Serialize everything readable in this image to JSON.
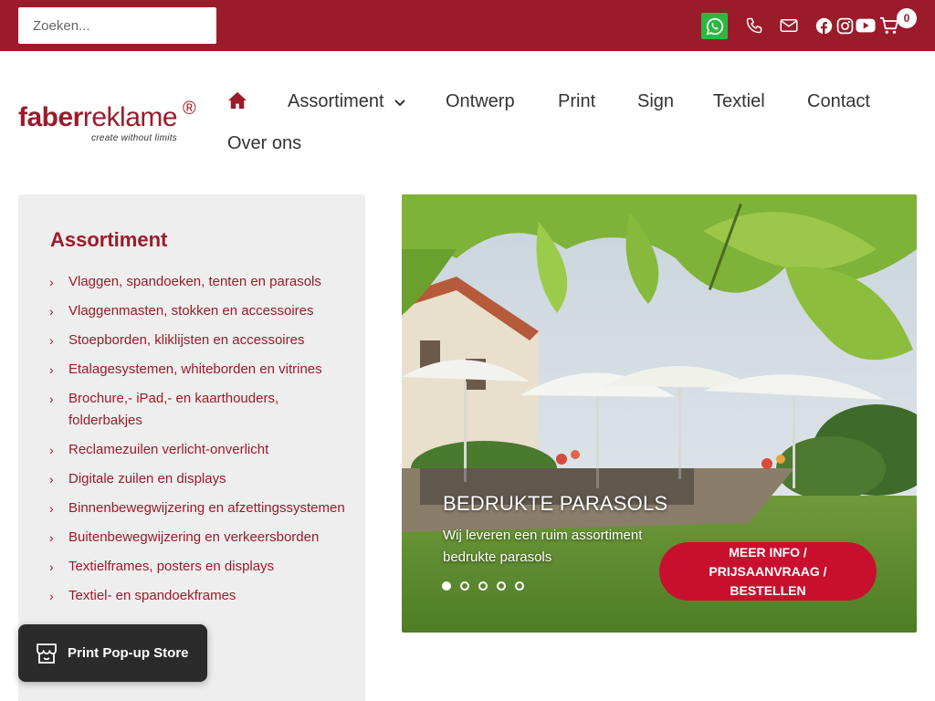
{
  "topbar": {
    "search_placeholder": "Zoeken...",
    "cart_count": "0",
    "icons": [
      "whatsapp-icon",
      "phone-icon",
      "mail-icon",
      "facebook-icon",
      "instagram-icon",
      "youtube-icon",
      "cart-icon"
    ]
  },
  "logo": {
    "word_bold": "faber",
    "word_light": "reklame",
    "registered": "®",
    "tagline": "create without limits"
  },
  "nav": {
    "home_icon": "home-icon",
    "items": [
      "Assortiment",
      "Ontwerp",
      "Print",
      "Sign",
      "Textiel",
      "Contact",
      "Over ons"
    ]
  },
  "sidebar": {
    "title": "Assortiment",
    "items": [
      "Vlaggen, spandoeken, tenten en parasols",
      "Vlaggenmasten, stokken en accessoires",
      "Stoepborden, kliklijsten en accessoires",
      "Etalagesystemen, whiteborden en vitrines",
      "Brochure,- iPad,- en kaarthouders, folderbakjes",
      "Reclamezuilen verlicht-onverlicht",
      "Digitale zuilen en displays",
      "Binnenbewegwijzering en afzettingssystemen",
      "Buitenbewegwijzering en verkeersborden",
      "Textielframes, posters en displays",
      "Textiel- en spandoekframes"
    ]
  },
  "hero": {
    "title": "BEDRUKTE PARASOLS",
    "subtitle": "Wij leveren een ruim assortiment bedrukte parasols",
    "button": "MEER INFO / PRIJSAANVRAAG / BESTELLEN",
    "slide_count": 5,
    "active_slide": 1
  },
  "popup": {
    "label": "Print Pop-up Store"
  },
  "colors": {
    "brand": "#9b1b2a",
    "cta": "#c8102e",
    "whatsapp": "#2db742"
  }
}
